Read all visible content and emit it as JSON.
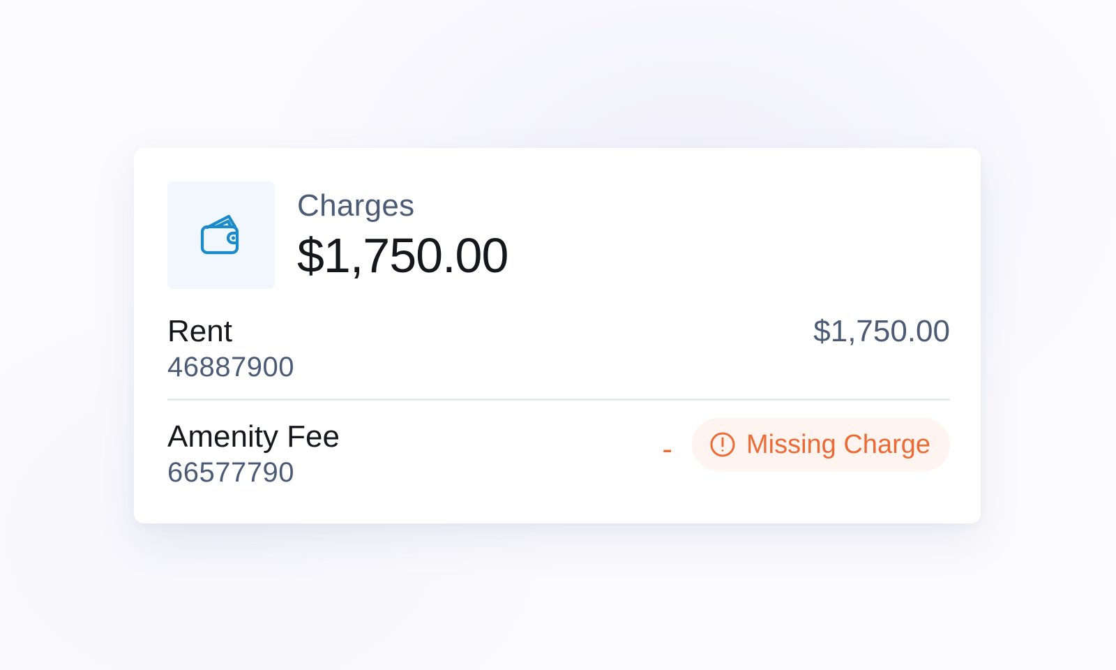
{
  "card": {
    "icon": "wallet-icon",
    "title": "Charges",
    "total": "$1,750.00"
  },
  "items": [
    {
      "name": "Rent",
      "code": "46887900",
      "amount": "$1,750.00"
    },
    {
      "name": "Amenity Fee",
      "code": "66577790",
      "amount": "-",
      "status": {
        "label": "Missing Charge",
        "icon": "alert-circle-icon",
        "color": "#ee6a35"
      }
    }
  ],
  "colors": {
    "accent": "#1a8ac8",
    "warning": "#ee6a35",
    "muted_text": "#4b5b75",
    "primary_text": "#15171c"
  }
}
